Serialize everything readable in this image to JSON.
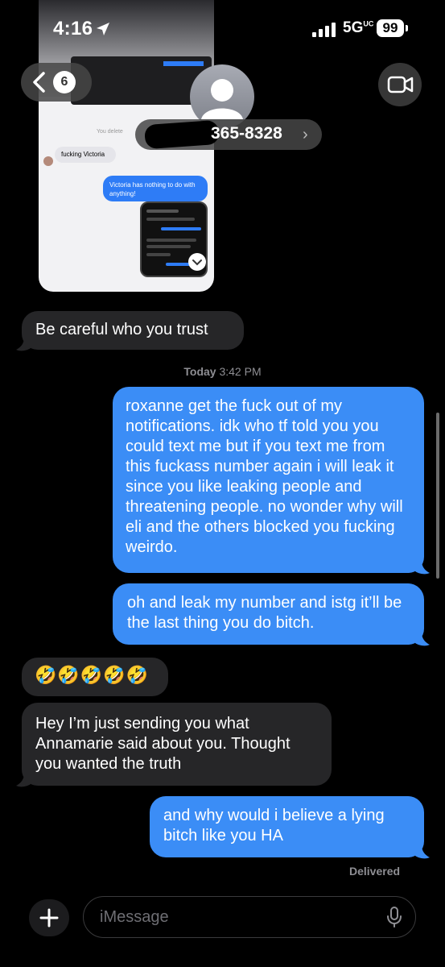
{
  "status_bar": {
    "time": "4:16",
    "network": "5G",
    "network_sup": "UC",
    "battery": "99"
  },
  "header": {
    "back_count": "6",
    "contact_number": "365-8328",
    "contact_chevron": "›"
  },
  "attachment": {
    "deleted_note": "You delete",
    "gray_text": "fucking Victoria",
    "blue_text": "Victoria has nothing to do with anything!"
  },
  "messages": [
    {
      "side": "received",
      "text": "Be careful who you trust"
    },
    {
      "side": "sent",
      "text": "roxanne get the fuck out of my notifications. idk who tf told you you could text me but if you text me from this fuckass number again i will leak it since you like leaking people and threatening people. no wonder why will eli and the others blocked you fucking weirdo."
    },
    {
      "side": "sent",
      "text": "oh and leak my number and istg it’ll be the last thing you do bitch."
    },
    {
      "side": "received",
      "text": "🤣🤣🤣🤣🤣"
    },
    {
      "side": "received",
      "text": "Hey I’m just sending you what Annamarie said about you. Thought you wanted the truth"
    },
    {
      "side": "sent",
      "text": "and why would i believe a lying bitch like you HA"
    }
  ],
  "timestamp": {
    "day": "Today",
    "time": "3:42 PM"
  },
  "delivered": "Delivered",
  "input": {
    "placeholder": "iMessage"
  },
  "colors": {
    "sent": "#3b8df6",
    "received": "#262628",
    "background": "#000000"
  }
}
